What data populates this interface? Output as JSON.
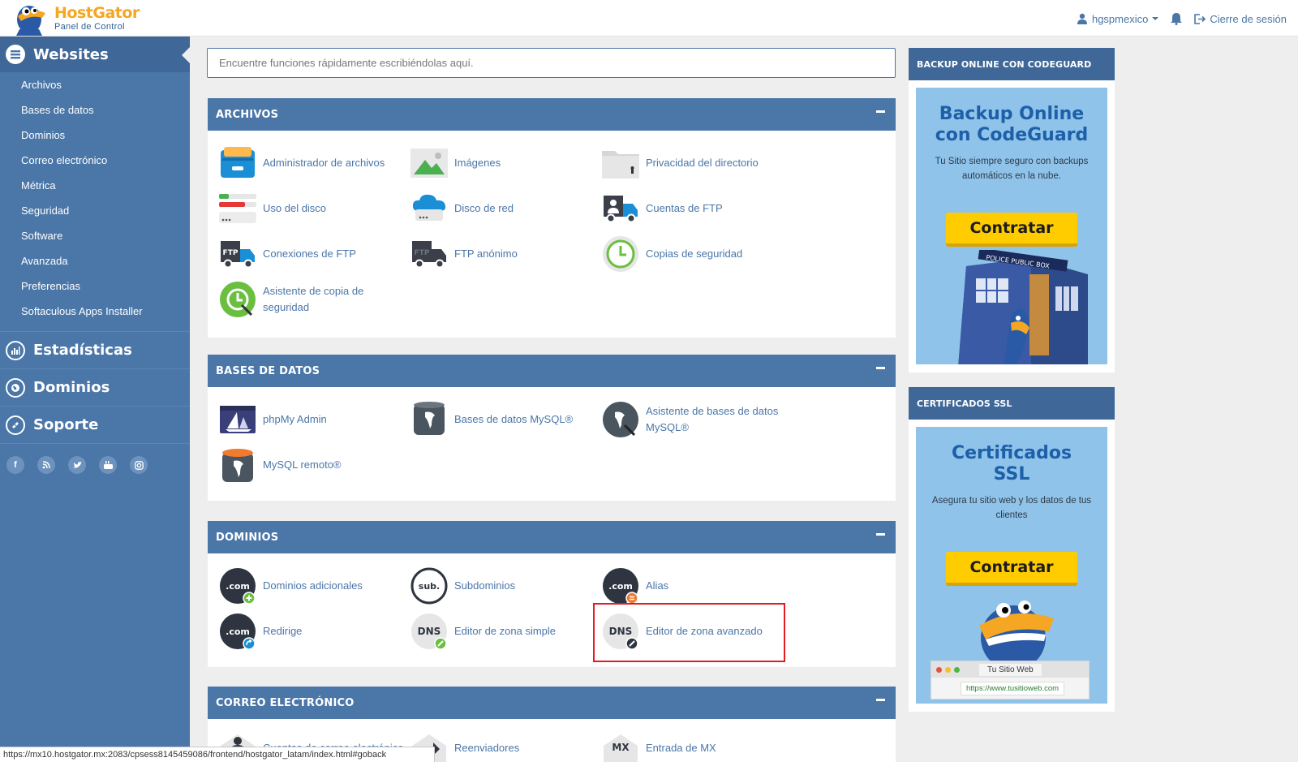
{
  "brand": {
    "name": "HostGator",
    "subtitle": "Panel de Control"
  },
  "header": {
    "username": "hgspmexico",
    "logout": "Cierre de sesión"
  },
  "sidebar": {
    "websites": "Websites",
    "items": [
      "Archivos",
      "Bases de datos",
      "Dominios",
      "Correo electrónico",
      "Métrica",
      "Seguridad",
      "Software",
      "Avanzada",
      "Preferencias",
      "Softaculous Apps Installer"
    ],
    "sections": [
      "Estadísticas",
      "Dominios",
      "Soporte"
    ]
  },
  "search": {
    "placeholder": "Encuentre funciones rápidamente escribiéndolas aquí."
  },
  "panels": {
    "archivos": {
      "title": "ARCHIVOS",
      "items": [
        "Administrador de archivos",
        "Imágenes",
        "Privacidad del directorio",
        "Uso del disco",
        "Disco de red",
        "Cuentas de FTP",
        "Conexiones de FTP",
        "FTP anónimo",
        "Copias de seguridad",
        "Asistente de copia de seguridad"
      ]
    },
    "bases": {
      "title": "BASES DE DATOS",
      "items": [
        "phpMy Admin",
        "Bases de datos MySQL®",
        "Asistente de bases de datos MySQL®",
        "MySQL remoto®"
      ]
    },
    "dominios": {
      "title": "DOMINIOS",
      "items": [
        "Dominios adicionales",
        "Subdominios",
        "Alias",
        "Redirige",
        "Editor de zona simple",
        "Editor de zona avanzado"
      ]
    },
    "correo": {
      "title": "CORREO ELECTRÓNICO",
      "items": [
        "Cuentas de correo electrónico",
        "Reenviadores",
        "Entrada de MX"
      ]
    }
  },
  "icon_text": {
    "com": ".com",
    "sub": "sub.",
    "dns": "DNS",
    "mx": "MX",
    "ftp": "FTP"
  },
  "ads": {
    "codeguard": {
      "header": "BACKUP ONLINE CON CODEGUARD",
      "title_line1": "Backup Online",
      "title_line2": "con CodeGuard",
      "text": "Tu Sitio siempre seguro con backups automáticos en la nube.",
      "button": "Contratar",
      "box_sign": "POLICE PUBLIC BOX"
    },
    "ssl": {
      "header": "CERTIFICADOS SSL",
      "title_line1": "Certificados",
      "title_line2": "SSL",
      "text": "Asegura tu sitio web y los datos de tus clientes",
      "button": "Contratar",
      "browser_tab": "Tu Sitio Web",
      "browser_url": "https://www.tusitioweb.com"
    }
  },
  "statusbar": {
    "url": "https://mx10.hostgator.mx:2083/cpsess8145459086/frontend/hostgator_latam/index.html#goback"
  },
  "colors": {
    "primary": "#4a76a8",
    "sidebar_dark": "#3f6797",
    "highlight": "#e11d24",
    "accent": "#ffcc00"
  }
}
